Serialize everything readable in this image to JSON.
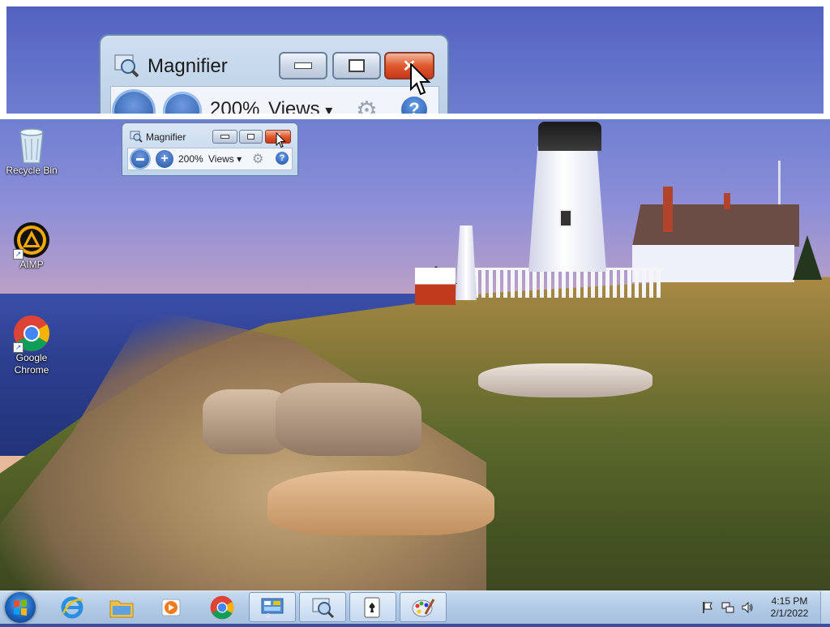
{
  "magnifier_window": {
    "title": "Magnifier",
    "zoom_level": "200%",
    "views_label": "Views",
    "views_arrow": "▾",
    "buttons": {
      "minimize_icon": "minimize-icon",
      "restore_icon": "restore-icon",
      "close_icon": "close-icon",
      "zoom_out_icon": "zoom-out-icon",
      "zoom_in_icon": "zoom-in-icon",
      "options_icon": "gear-icon",
      "help_icon": "help-icon",
      "help_glyph": "?"
    }
  },
  "desktop_icons": [
    {
      "label": "Recycle Bin",
      "icon": "recycle-bin-icon"
    },
    {
      "label": "AIMP",
      "icon": "aimp-icon"
    },
    {
      "label": "Google Chrome",
      "label_line1": "Google",
      "label_line2": "Chrome",
      "icon": "chrome-icon"
    }
  ],
  "taskbar": {
    "start_icon": "windows-start-icon",
    "pinned": [
      {
        "name": "internet-explorer",
        "icon": "ie-icon"
      },
      {
        "name": "windows-explorer",
        "icon": "folder-icon"
      },
      {
        "name": "media-player",
        "icon": "media-player-icon"
      },
      {
        "name": "google-chrome",
        "icon": "chrome-icon"
      },
      {
        "name": "control-panel",
        "icon": "control-panel-icon"
      },
      {
        "name": "magnifier",
        "icon": "magnifier-icon"
      },
      {
        "name": "solitaire",
        "icon": "solitaire-icon"
      },
      {
        "name": "paint",
        "icon": "paint-icon"
      }
    ],
    "tray": {
      "icons": [
        "action-center-flag-icon",
        "network-icon",
        "volume-icon"
      ],
      "time": "4:15 PM",
      "date": "2/1/2022"
    }
  },
  "colors": {
    "accent": "#2b5fb0",
    "close_button": "#e05a2e",
    "taskbar": "#b3cbe6"
  }
}
